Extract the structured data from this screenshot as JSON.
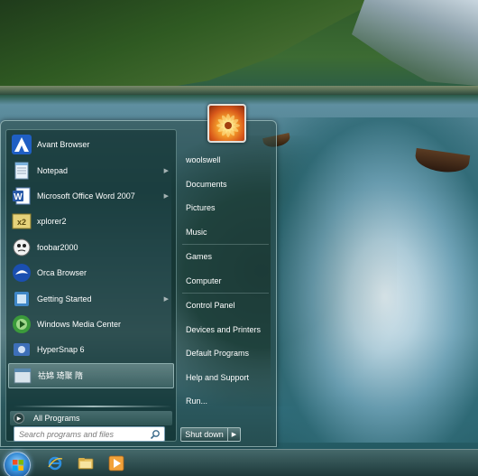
{
  "start_menu": {
    "programs": [
      {
        "label": "Avant Browser",
        "icon": "avant-browser-icon",
        "has_submenu": false,
        "selected": false
      },
      {
        "label": "Notepad",
        "icon": "notepad-icon",
        "has_submenu": true,
        "selected": false
      },
      {
        "label": "Microsoft Office Word 2007",
        "icon": "word-icon",
        "has_submenu": true,
        "selected": false
      },
      {
        "label": "xplorer2",
        "icon": "xplorer2-icon",
        "has_submenu": false,
        "selected": false
      },
      {
        "label": "foobar2000",
        "icon": "foobar2000-icon",
        "has_submenu": false,
        "selected": false
      },
      {
        "label": "Orca Browser",
        "icon": "orca-browser-icon",
        "has_submenu": false,
        "selected": false
      },
      {
        "label": "Getting Started",
        "icon": "getting-started-icon",
        "has_submenu": true,
        "selected": false
      },
      {
        "label": "Windows Media Center",
        "icon": "media-center-icon",
        "has_submenu": false,
        "selected": false
      },
      {
        "label": "HyperSnap 6",
        "icon": "hypersnap-icon",
        "has_submenu": false,
        "selected": false
      },
      {
        "label": "祜婂 琦聚    隋",
        "icon": "app-icon",
        "has_submenu": false,
        "selected": true
      }
    ],
    "all_programs_label": "All Programs",
    "search_placeholder": "Search programs and files",
    "right_items": [
      {
        "label": "woolswell",
        "name": "right-item-user"
      },
      {
        "label": "Documents",
        "name": "right-item-documents"
      },
      {
        "label": "Pictures",
        "name": "right-item-pictures"
      },
      {
        "label": "Music",
        "name": "right-item-music"
      },
      {
        "label": "Games",
        "name": "right-item-games"
      },
      {
        "label": "Computer",
        "name": "right-item-computer"
      },
      {
        "label": "Control Panel",
        "name": "right-item-control-panel"
      },
      {
        "label": "Devices and Printers",
        "name": "right-item-devices-printers"
      },
      {
        "label": "Default Programs",
        "name": "right-item-default-programs"
      },
      {
        "label": "Help and Support",
        "name": "right-item-help-support"
      },
      {
        "label": "Run...",
        "name": "right-item-run"
      }
    ],
    "shutdown_label": "Shut down"
  },
  "taskbar": {
    "icons": [
      "start-orb-icon",
      "internet-explorer-icon",
      "windows-explorer-icon",
      "media-player-icon"
    ]
  },
  "colors": {
    "menu_glass": "#284644",
    "accent_orb": "#3a8fd8"
  }
}
